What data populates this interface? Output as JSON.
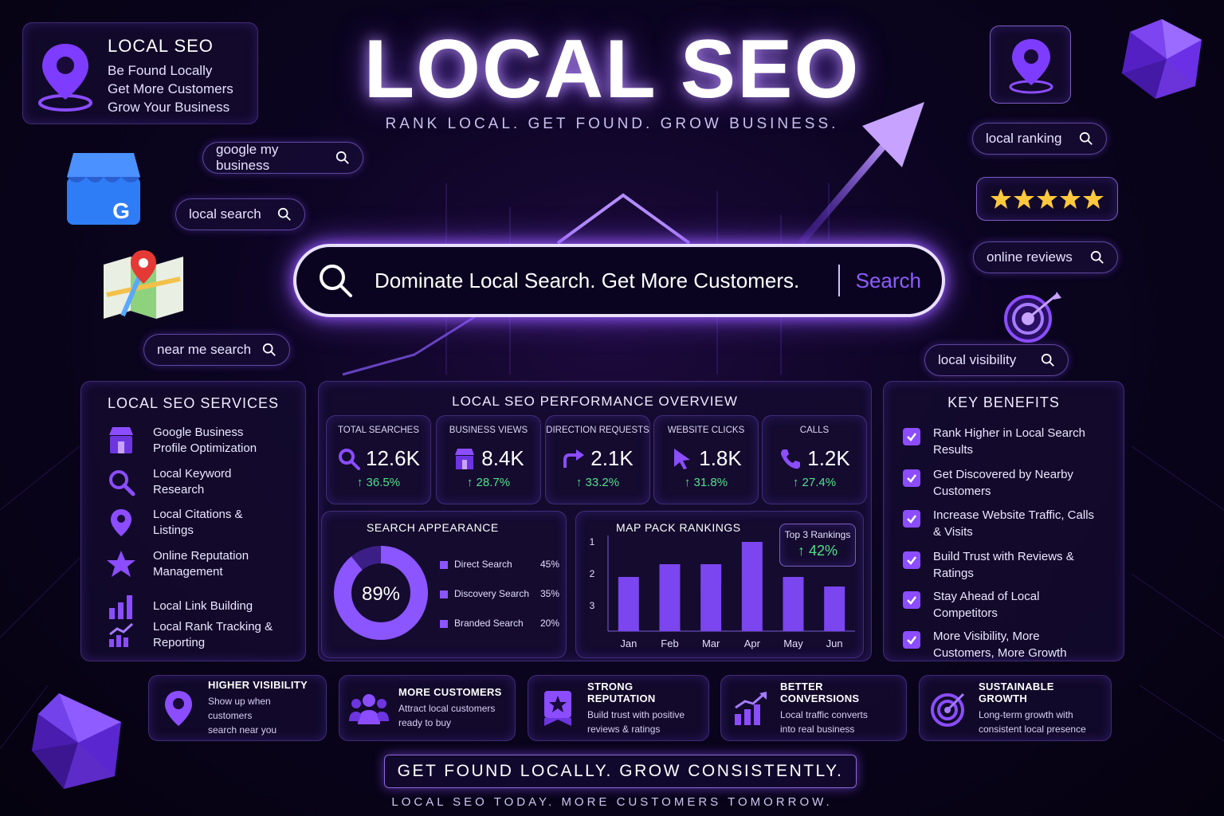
{
  "header": {
    "title": "LOCAL SEO",
    "subtitle": "RANK LOCAL. GET FOUND. GROW BUSINESS."
  },
  "intro_card": {
    "title": "LOCAL SEO",
    "lines": [
      "Be Found Locally",
      "Get More Customers",
      "Grow Your Business"
    ]
  },
  "pills": {
    "google_my_business": "google my business",
    "local_search": "local search",
    "near_me_search": "near me search",
    "local_ranking": "local ranking",
    "online_reviews": "online reviews",
    "local_visibility": "local visibility"
  },
  "search": {
    "query": "Dominate Local Search. Get More Customers.",
    "button": "Search"
  },
  "reviews": {
    "stars": 5
  },
  "services": {
    "title": "LOCAL SEO SERVICES",
    "items": [
      {
        "label": "Google Business Profile Optimization",
        "icon": "store-icon"
      },
      {
        "label": "Local Keyword Research",
        "icon": "magnifier-icon"
      },
      {
        "label": "Local Citations & Listings",
        "icon": "map-pin-icon"
      },
      {
        "label": "Online Reputation Management",
        "icon": "star-icon"
      },
      {
        "label": "Local Link Building",
        "icon": "bar-chart-icon"
      },
      {
        "label": "Local Rank Tracking & Reporting",
        "icon": "growth-chart-icon"
      }
    ]
  },
  "performance": {
    "title": "LOCAL SEO PERFORMANCE OVERVIEW",
    "metrics": [
      {
        "label": "TOTAL SEARCHES",
        "value": "12.6K",
        "change": "↑ 36.5%",
        "icon": "magnifier-icon"
      },
      {
        "label": "BUSINESS VIEWS",
        "value": "8.4K",
        "change": "↑ 28.7%",
        "icon": "store-icon"
      },
      {
        "label": "DIRECTION REQUESTS",
        "value": "2.1K",
        "change": "↑ 33.2%",
        "icon": "direction-arrow-icon"
      },
      {
        "label": "WEBSITE CLICKS",
        "value": "1.8K",
        "change": "↑ 31.8%",
        "icon": "cursor-icon"
      },
      {
        "label": "CALLS",
        "value": "1.2K",
        "change": "↑ 27.4%",
        "icon": "phone-icon"
      }
    ]
  },
  "search_appearance": {
    "title": "SEARCH APPEARANCE",
    "center": "89%",
    "fraction": 0.89,
    "legend": [
      {
        "label": "Direct Search",
        "value": "45%"
      },
      {
        "label": "Discovery Search",
        "value": "35%"
      },
      {
        "label": "Branded Search",
        "value": "20%"
      }
    ]
  },
  "map_pack": {
    "title": "MAP PACK RANKINGS",
    "tooltip_title": "Top 3 Rankings",
    "tooltip_value": "↑ 42%"
  },
  "chart_data": {
    "type": "bar",
    "title": "MAP PACK RANKINGS",
    "categories": [
      "Jan",
      "Feb",
      "Mar",
      "Apr",
      "May",
      "Jun"
    ],
    "values": [
      2.1,
      1.7,
      1.7,
      1.0,
      2.1,
      2.4
    ],
    "yticks": [
      "1",
      "2",
      "3"
    ],
    "ylim": [
      3.8,
      0.8
    ],
    "annotation": {
      "title": "Top 3 Rankings",
      "value": "↑ 42%"
    }
  },
  "benefits": {
    "title": "KEY BENEFITS",
    "items": [
      "Rank Higher in Local Search Results",
      "Get Discovered by Nearby Customers",
      "Increase Website Traffic, Calls & Visits",
      "Build Trust with Reviews & Ratings",
      "Stay Ahead of Local Competitors",
      "More Visibility, More Customers, More Growth"
    ]
  },
  "feature_cards": [
    {
      "title": "HIGHER VISIBILITY",
      "desc1": "Show up when customers",
      "desc2": "search near you",
      "icon": "map-pin-icon"
    },
    {
      "title": "MORE CUSTOMERS",
      "desc1": "Attract local customers",
      "desc2": "ready to buy",
      "icon": "people-icon"
    },
    {
      "title": "STRONG REPUTATION",
      "desc1": "Build trust with positive",
      "desc2": "reviews & ratings",
      "icon": "badge-star-icon"
    },
    {
      "title": "BETTER CONVERSIONS",
      "desc1": "Local traffic converts",
      "desc2": "into real business",
      "icon": "growth-chart-icon"
    },
    {
      "title": "SUSTAINABLE GROWTH",
      "desc1": "Long-term growth with",
      "desc2": "consistent local presence",
      "icon": "target-icon"
    }
  ],
  "footer": {
    "banner": "GET FOUND LOCALLY. GROW CONSISTENTLY.",
    "tagline": "LOCAL SEO TODAY. MORE CUSTOMERS TOMORROW."
  },
  "colors": {
    "accent": "#8b4dff",
    "positive": "#4fe08a",
    "background": "#0b0420",
    "star": "#ffc83d"
  }
}
